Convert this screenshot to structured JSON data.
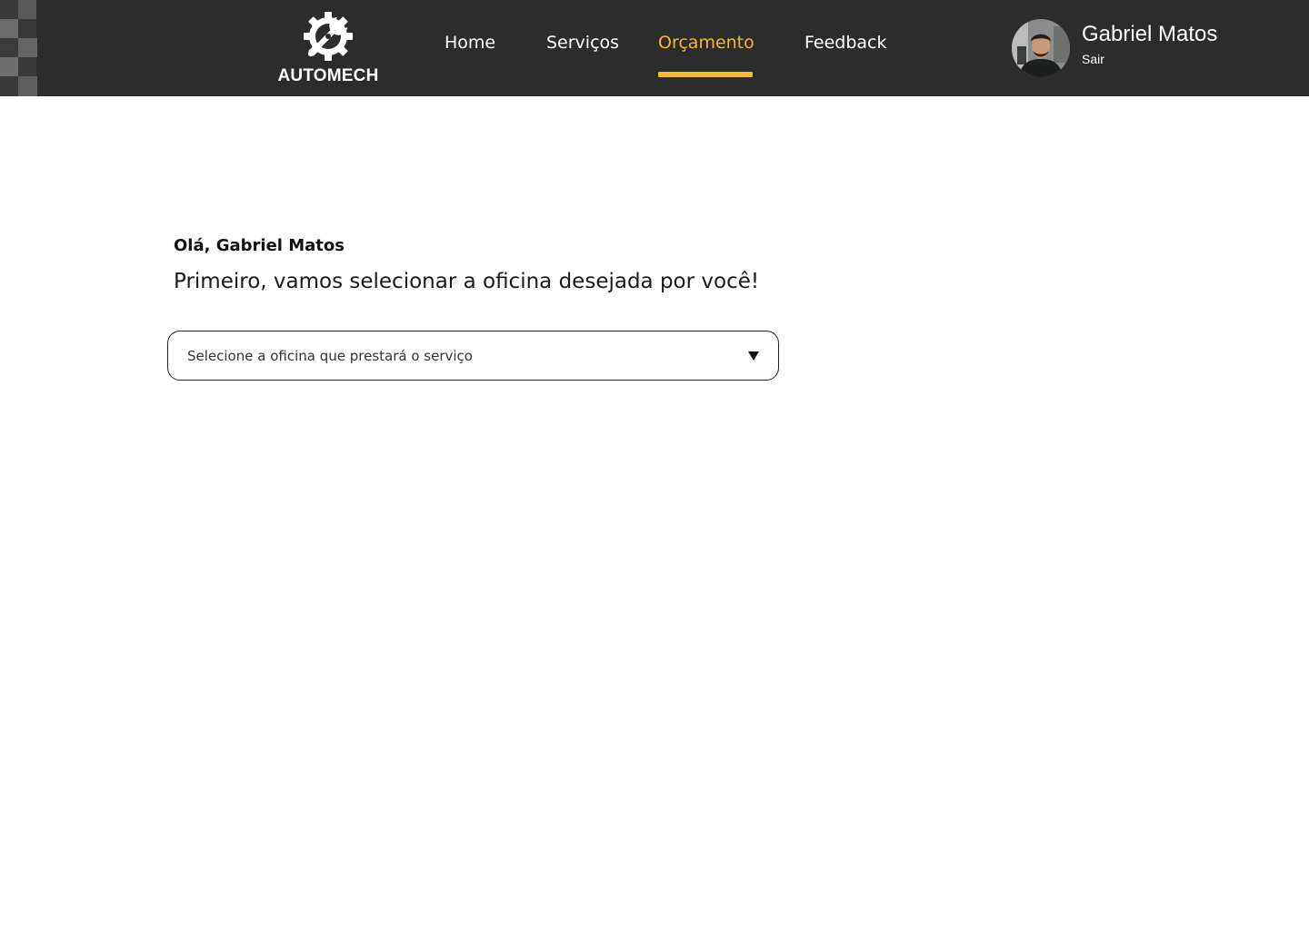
{
  "brand": {
    "name": "AUTOMECH",
    "logo_icon": "gear-wrench-icon"
  },
  "nav": {
    "items": [
      {
        "label": "Home",
        "active": false
      },
      {
        "label": "Serviços",
        "active": false
      },
      {
        "label": "Orçamento",
        "active": true
      },
      {
        "label": "Feedback",
        "active": false
      }
    ]
  },
  "user": {
    "name": "Gabriel Matos",
    "logout_label": "Sair",
    "avatar_icon": "user-avatar"
  },
  "main": {
    "greeting": "Olá, Gabriel Matos",
    "subtitle": "Primeiro, vamos selecionar a oficina desejada por você!",
    "workshop_select": {
      "placeholder": "Selecione a oficina que prestará o serviço",
      "arrow_icon": "triangle-down-icon"
    }
  },
  "colors": {
    "header_bg": "#2c2c2c",
    "accent": "#f6b92b",
    "text_light": "#ffffff",
    "text_dark": "#111111"
  }
}
